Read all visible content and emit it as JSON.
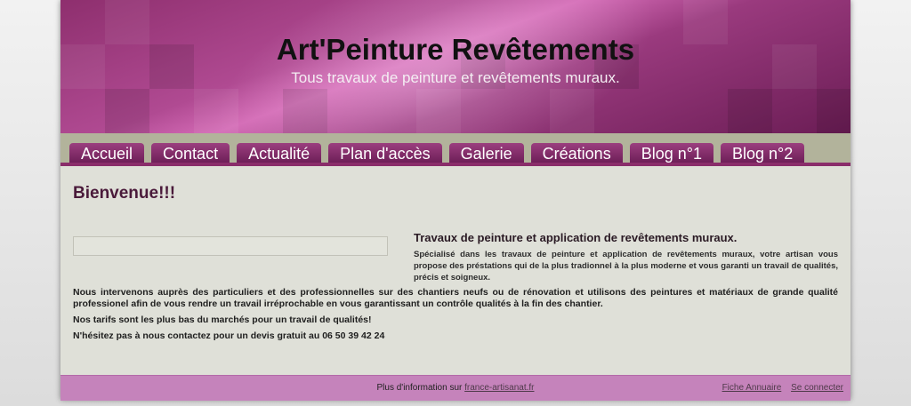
{
  "header": {
    "title": "Art'Peinture Revêtements",
    "subtitle": "Tous travaux de peinture et revêtements muraux."
  },
  "nav": {
    "items": [
      "Accueil",
      "Contact",
      "Actualité",
      "Plan d'accès",
      "Galerie",
      "Créations",
      "Blog n°1",
      "Blog n°2"
    ]
  },
  "main": {
    "heading": "Bienvenue!!!",
    "right_title": "Travaux de peinture et application de revêtements muraux.",
    "right_text": "Spécialisé dans les travaux de peinture et application de revêtements muraux, votre artisan vous propose des préstations qui de la plus tradionnel à la plus moderne et vous garanti un travail de qualités, précis et soigneux.",
    "paragraph1": "Nous intervenons auprès des particuliers et des professionnelles sur des chantiers neufs ou de rénovation et utilisons des peintures et matériaux de grande qualité professionel afin de vous rendre un travail irréprochable en vous garantissant un contrôle qualités à la fin des chantier.",
    "paragraph2": "Nos tarifs sont les plus bas du marchés pour un travail de qualités!",
    "paragraph3": "N'hésitez pas à nous contactez pour un devis gratuit au 06 50 39 42 24"
  },
  "footer": {
    "info_prefix": "Plus d'information sur",
    "info_link": "france-artisanat.fr",
    "link1": "Fiche Annuaire",
    "link2": "Se connecter"
  }
}
